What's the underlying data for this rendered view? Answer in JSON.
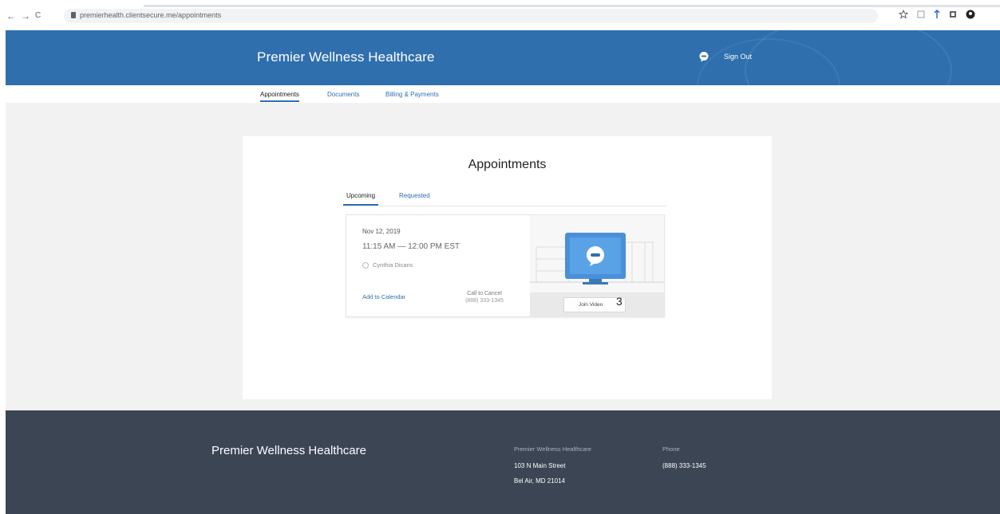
{
  "browser": {
    "nav_back": "←",
    "nav_forward": "→",
    "nav_reload": "C",
    "url": "premierhealth.clientsecure.me/appointments"
  },
  "header": {
    "brand": "Premier Wellness Healthcare",
    "sign_out": "Sign Out",
    "colors": {
      "primary": "#2f6fae"
    }
  },
  "nav": {
    "tabs": [
      {
        "label": "Appointments"
      },
      {
        "label": "Documents"
      },
      {
        "label": "Billing & Payments"
      }
    ]
  },
  "page": {
    "title": "Appointments",
    "subtabs": [
      {
        "label": "Upcoming"
      },
      {
        "label": "Requested"
      }
    ],
    "appointment": {
      "date": "Nov 12, 2019",
      "time": "11:15 AM — 12:00 PM EST",
      "provider": "Cynthia Dicans",
      "add_to_calendar": "Add to Calendar",
      "call_to_cancel": "Call to Cancel",
      "cancel_phone": "(888) 333-1345",
      "join_video": "Join Video",
      "annotation": "3"
    }
  },
  "footer": {
    "brand": "Premier Wellness Healthcare",
    "address_heading": "Premier Wellness Healthcare",
    "address_line1": "103 N Main Street",
    "address_line2": "Bel Air, MD 21014",
    "phone_heading": "Phone",
    "phone": "(888) 333-1345"
  }
}
